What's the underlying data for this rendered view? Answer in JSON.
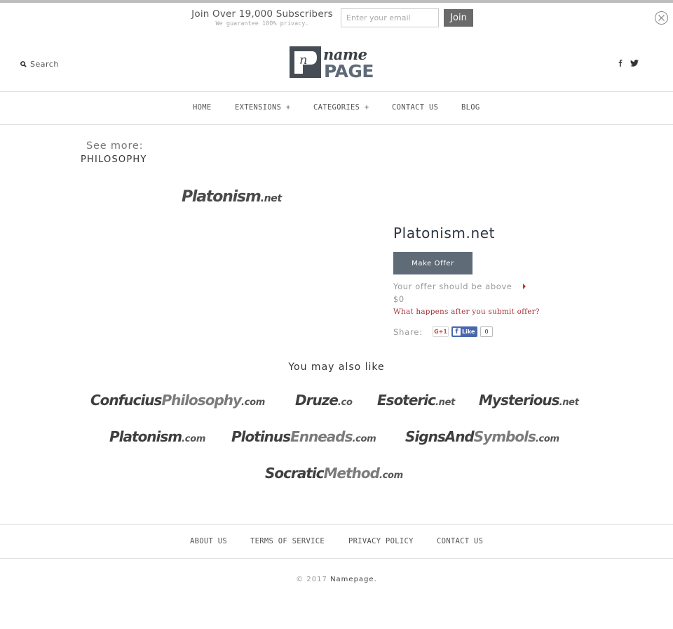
{
  "subscribe": {
    "title": "Join Over 19,000 Subscribers",
    "note": "We guarantee 100% privacy.",
    "email_placeholder": "Enter your email",
    "email_value": "",
    "join_label": "Join"
  },
  "header": {
    "search_label": "Search",
    "logo": {
      "top_word": "name",
      "bottom_word": "PAGE",
      "mark_letter": "n"
    },
    "social": [
      "facebook-icon",
      "twitter-icon"
    ]
  },
  "nav": {
    "items": [
      {
        "label": "HOME"
      },
      {
        "label": "EXTENSIONS +"
      },
      {
        "label": "CATEGORIES +"
      },
      {
        "label": "CONTACT US"
      },
      {
        "label": "BLOG"
      }
    ]
  },
  "see_more": {
    "label": "See more:",
    "category": "PHILOSOPHY"
  },
  "product": {
    "wordmark_main": "Platonism",
    "wordmark_tld": ".net",
    "title": "Platonism.net",
    "offer_button": "Make Offer",
    "offer_note": "Your offer should be above",
    "offer_amount": "$0",
    "offer_help": "What happens after you submit offer?",
    "share_label": "Share:",
    "gplus_label": "G+1",
    "fb_like_label": "Like",
    "fb_count": "0"
  },
  "related": {
    "title": "You may also like",
    "domains": [
      {
        "part1": "Confucius",
        "part2": "Philosophy",
        "tld": ".com"
      },
      {
        "part1": "Druze",
        "part2": "",
        "tld": ".co"
      },
      {
        "part1": "Esoteric",
        "part2": "",
        "tld": ".net"
      },
      {
        "part1": "Mysterious",
        "part2": "",
        "tld": ".net"
      },
      {
        "part1": "Platonism",
        "part2": "",
        "tld": ".com"
      },
      {
        "part1": "Plotinus",
        "part2": "Enneads",
        "tld": ".com"
      },
      {
        "part1": "SignsAnd",
        "part2": "Symbols",
        "tld": ".com"
      },
      {
        "part1": "Socratic",
        "part2": "Method",
        "tld": ".com"
      }
    ]
  },
  "footer": {
    "links": [
      {
        "label": "ABOUT US"
      },
      {
        "label": "TERMS OF SERVICE"
      },
      {
        "label": "PRIVACY POLICY"
      },
      {
        "label": "CONTACT US"
      }
    ],
    "copyright_prefix": "© 2017",
    "copyright_brand": "Namepage."
  },
  "colors": {
    "accent_button": "#5f6b77",
    "help_link": "#a3343b",
    "logo_dark": "#474d55",
    "logo_blue_gray": "#5e6a78"
  }
}
